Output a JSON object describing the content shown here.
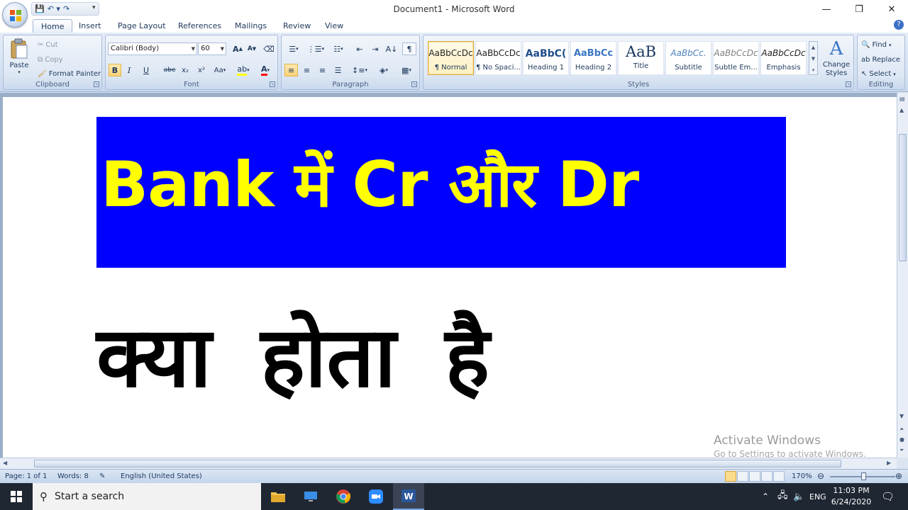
{
  "window": {
    "title": "Document1 - Microsoft Word",
    "minimize": "—",
    "maximize": "❐",
    "close": "✕"
  },
  "tabs": [
    {
      "label": "Home"
    },
    {
      "label": "Insert"
    },
    {
      "label": "Page Layout"
    },
    {
      "label": "References"
    },
    {
      "label": "Mailings"
    },
    {
      "label": "Review"
    },
    {
      "label": "View"
    }
  ],
  "clipboard": {
    "paste": "Paste",
    "cut": "Cut",
    "copy": "Copy",
    "format_painter": "Format Painter",
    "label": "Clipboard"
  },
  "font": {
    "font_name": "Calibri (Body)",
    "font_size": "60",
    "label": "Font",
    "bold": "B",
    "italic": "I",
    "underline": "U",
    "strikethrough": "abe",
    "subscript": "x₂",
    "superscript": "x²",
    "change_case": "Aa",
    "grow": "A",
    "shrink": "A"
  },
  "paragraph": {
    "label": "Paragraph",
    "show_marks": "¶"
  },
  "styles": {
    "label": "Styles",
    "change_styles": "Change Styles",
    "items": [
      {
        "sample": "AaBbCcDc",
        "name": "¶ Normal"
      },
      {
        "sample": "AaBbCcDc",
        "name": "¶ No Spaci..."
      },
      {
        "sample": "AaBbC(",
        "name": "Heading 1"
      },
      {
        "sample": "AaBbCc",
        "name": "Heading 2"
      },
      {
        "sample": "AaB",
        "name": "Title"
      },
      {
        "sample": "AaBbCc.",
        "name": "Subtitle"
      },
      {
        "sample": "AaBbCcDc",
        "name": "Subtle Em..."
      },
      {
        "sample": "AaBbCcDc",
        "name": "Emphasis"
      }
    ]
  },
  "editing": {
    "find": "Find",
    "replace": "Replace",
    "select": "Select",
    "label": "Editing"
  },
  "document": {
    "banner_text": "Bank में  Cr और  Dr",
    "body_text": "क्या होता है",
    "banner_bg": "#0000fe",
    "banner_fg": "#ffff00"
  },
  "watermark": {
    "line1": "Activate Windows",
    "line2": "Go to Settings to activate Windows."
  },
  "status": {
    "page": "Page: 1 of 1",
    "words": "Words: 8",
    "language": "English (United States)",
    "zoom": "170%"
  },
  "taskbar": {
    "search_placeholder": "Start a search",
    "lang": "ENG",
    "time": "11:03 PM",
    "date": "6/24/2020"
  }
}
